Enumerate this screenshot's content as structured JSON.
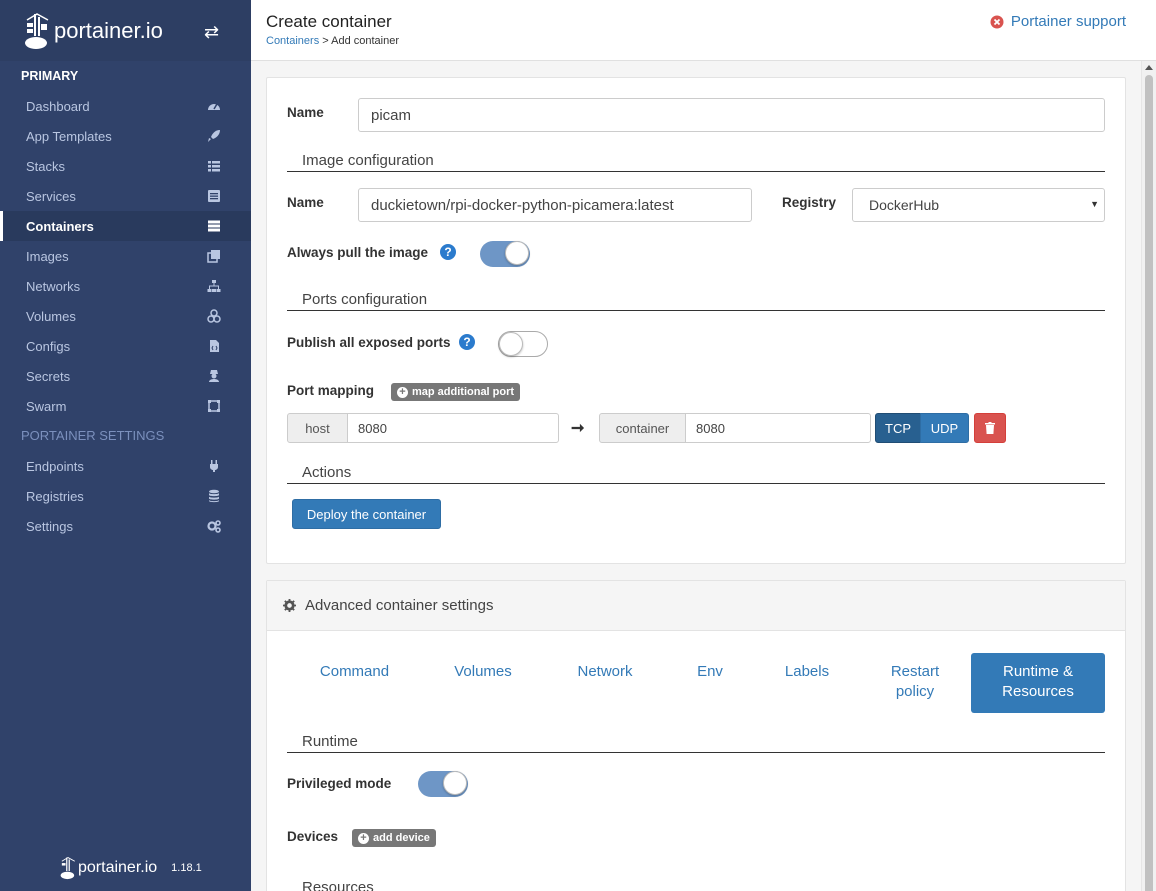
{
  "brand": {
    "name": "portainer.io",
    "version": "1.18.1"
  },
  "sidebar": {
    "heading_primary": "PRIMARY",
    "items": [
      {
        "label": "Dashboard",
        "icon": "tachometer-icon"
      },
      {
        "label": "App Templates",
        "icon": "rocket-icon"
      },
      {
        "label": "Stacks",
        "icon": "th-list-icon"
      },
      {
        "label": "Services",
        "icon": "list-alt-icon"
      },
      {
        "label": "Containers",
        "icon": "server-icon",
        "active": true
      },
      {
        "label": "Images",
        "icon": "clone-icon"
      },
      {
        "label": "Networks",
        "icon": "sitemap-icon"
      },
      {
        "label": "Volumes",
        "icon": "cubes-icon"
      },
      {
        "label": "Configs",
        "icon": "file-code-icon"
      },
      {
        "label": "Secrets",
        "icon": "user-secret-icon"
      },
      {
        "label": "Swarm",
        "icon": "object-group-icon"
      }
    ],
    "heading_settings": "PORTAINER SETTINGS",
    "settings_items": [
      {
        "label": "Endpoints",
        "icon": "plug-icon"
      },
      {
        "label": "Registries",
        "icon": "database-icon"
      },
      {
        "label": "Settings",
        "icon": "cogs-icon"
      }
    ]
  },
  "header": {
    "title": "Create container",
    "breadcrumb_link": "Containers",
    "breadcrumb_current": "> Add container",
    "support": "Portainer support"
  },
  "form": {
    "name_label": "Name",
    "name_value": "picam",
    "image_section": "Image configuration",
    "image_name_label": "Name",
    "image_value": "duckietown/rpi-docker-python-picamera:latest",
    "registry_label": "Registry",
    "registry_value": "DockerHub",
    "always_pull_label": "Always pull the image",
    "always_pull": true,
    "ports_section": "Ports configuration",
    "publish_label": "Publish all exposed ports",
    "publish": false,
    "port_mapping_label": "Port mapping",
    "map_port_button": "map additional port",
    "host_addon": "host",
    "host_value": "8080",
    "container_addon": "container",
    "container_value": "8080",
    "tcp_label": "TCP",
    "udp_label": "UDP",
    "actions_section": "Actions",
    "deploy_label": "Deploy the container"
  },
  "advanced": {
    "title": "Advanced container settings",
    "tabs": [
      "Command",
      "Volumes",
      "Network",
      "Env",
      "Labels",
      "Restart policy",
      "Runtime & Resources"
    ],
    "active_tab": "Runtime & Resources",
    "runtime_section": "Runtime",
    "privileged_label": "Privileged mode",
    "privileged": true,
    "devices_label": "Devices",
    "add_device_button": "add device",
    "resources_section": "Resources"
  },
  "colors": {
    "sidebar": "#30426a",
    "accent": "#337ab7",
    "danger": "#d9534f"
  }
}
